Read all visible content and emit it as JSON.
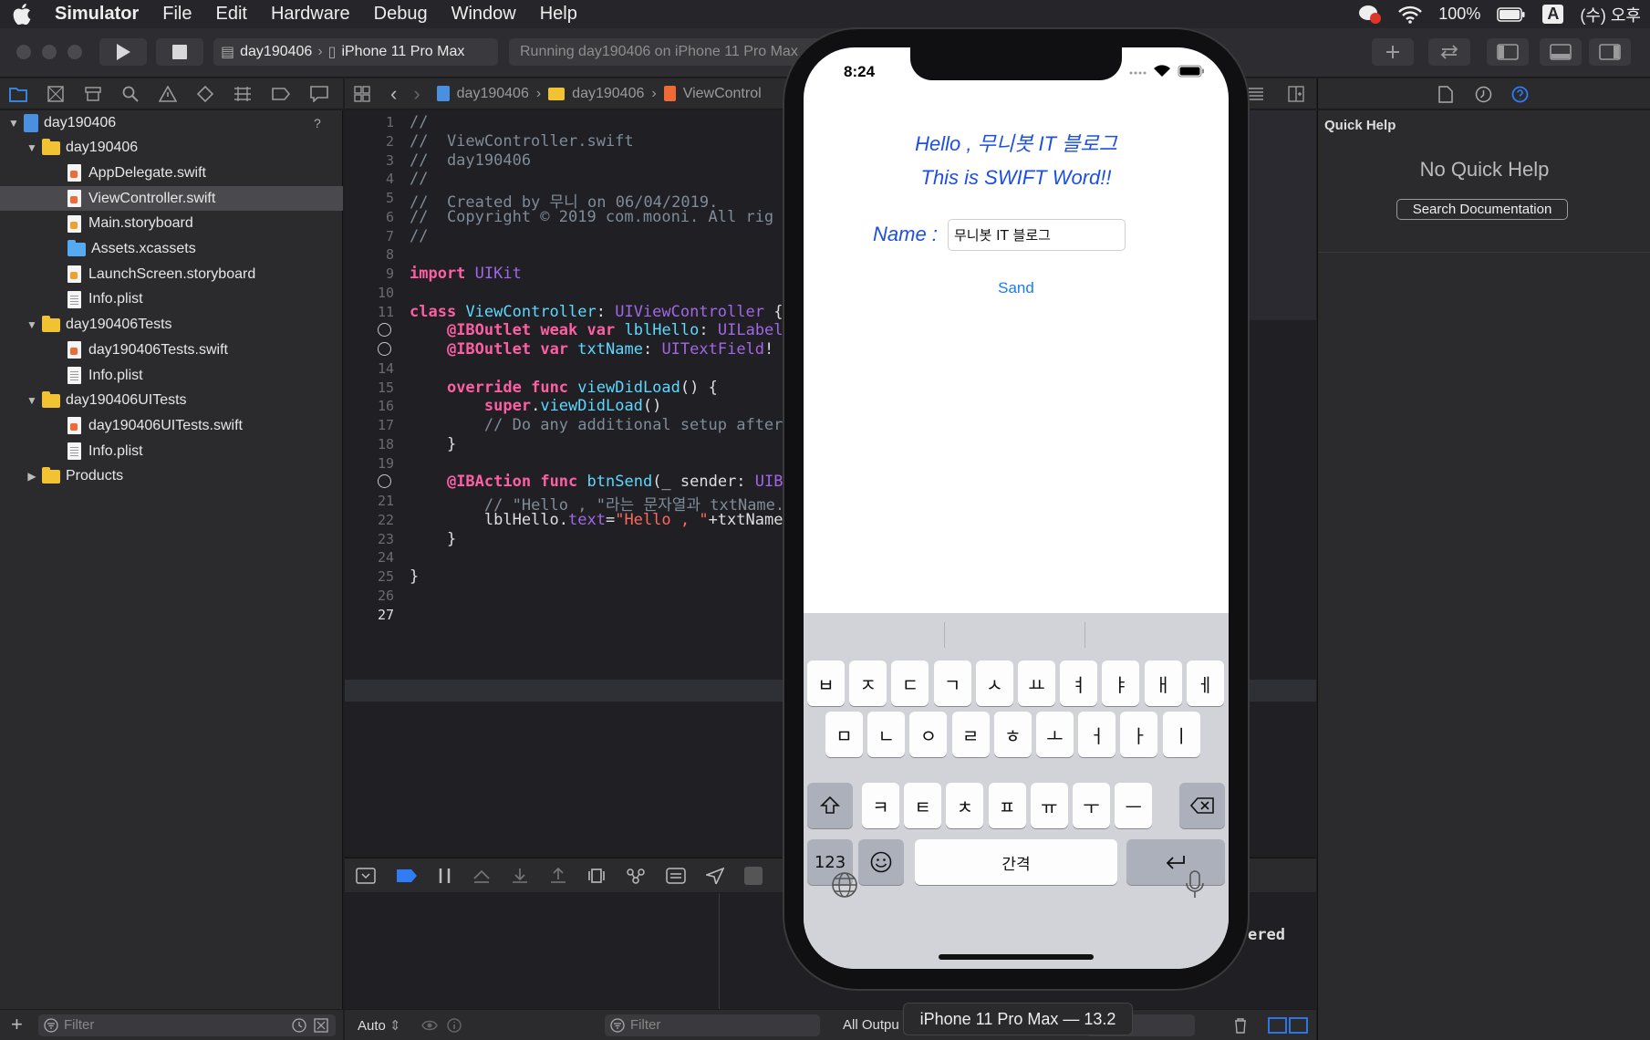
{
  "menubar": {
    "app_name": "Simulator",
    "items": [
      "File",
      "Edit",
      "Hardware",
      "Debug",
      "Window",
      "Help"
    ],
    "battery": "100%",
    "input_source": "A",
    "clock": "(수) 오후"
  },
  "toolbar": {
    "scheme_project": "day190406",
    "scheme_device": "iPhone 11 Pro Max",
    "activity": "Running day190406 on iPhone 11 Pro Max"
  },
  "navigator": {
    "badge": "?",
    "items": [
      {
        "label": "day190406",
        "kind": "project",
        "level": 0,
        "expanded": true
      },
      {
        "label": "day190406",
        "kind": "folder",
        "level": 1,
        "expanded": true
      },
      {
        "label": "AppDelegate.swift",
        "kind": "swift",
        "level": 2
      },
      {
        "label": "ViewController.swift",
        "kind": "swift",
        "level": 2,
        "selected": true
      },
      {
        "label": "Main.storyboard",
        "kind": "storyboard",
        "level": 2
      },
      {
        "label": "Assets.xcassets",
        "kind": "assets",
        "level": 2
      },
      {
        "label": "LaunchScreen.storyboard",
        "kind": "storyboard",
        "level": 2
      },
      {
        "label": "Info.plist",
        "kind": "plist",
        "level": 2
      },
      {
        "label": "day190406Tests",
        "kind": "folder",
        "level": 1,
        "expanded": true
      },
      {
        "label": "day190406Tests.swift",
        "kind": "swift",
        "level": 2
      },
      {
        "label": "Info.plist",
        "kind": "plist",
        "level": 2
      },
      {
        "label": "day190406UITests",
        "kind": "folder",
        "level": 1,
        "expanded": true
      },
      {
        "label": "day190406UITests.swift",
        "kind": "swift",
        "level": 2
      },
      {
        "label": "Info.plist",
        "kind": "plist",
        "level": 2
      },
      {
        "label": "Products",
        "kind": "folder",
        "level": 1,
        "expanded": false
      }
    ],
    "filter_placeholder": "Filter"
  },
  "jumpbar": {
    "crumbs": [
      "day190406",
      "day190406",
      "ViewControl"
    ]
  },
  "editor": {
    "current_line": 27,
    "breakpoint_lines": [
      12,
      13,
      20
    ],
    "lines": [
      "//",
      "//  ViewController.swift",
      "//  day190406",
      "//",
      "//  Created by 무니 on 06/04/2019.",
      "//  Copyright © 2019 com.mooni. All rig",
      "//",
      "",
      "import UIKit",
      "",
      "class ViewController: UIViewController {",
      "    @IBOutlet weak var lblHello: UILabel!",
      "    @IBOutlet var txtName: UITextField!",
      "",
      "    override func viewDidLoad() {",
      "        super.viewDidLoad()",
      "        // Do any additional setup after",
      "    }",
      "",
      "    @IBAction func btnSend(_ sender: UIB",
      "        // \"Hello , \"라는 문자열과 txtName.t",
      "        lblHello.text=\"Hello , \"+txtName",
      "    }",
      "",
      "}",
      "",
      ""
    ]
  },
  "debug": {
    "auto_label": "Auto",
    "filter_placeholder": "Filter",
    "output_label": "All Outpu",
    "console_text": "ered"
  },
  "inspector": {
    "title": "Quick Help",
    "empty_text": "No Quick Help",
    "search_button": "Search Documentation"
  },
  "phone": {
    "time": "8:24",
    "hello_label": "Hello , 무니봇 IT 블로그",
    "word_label": "This is SWIFT Word!!",
    "name_label": "Name :",
    "name_value": "무니봇 IT 블로그",
    "send_button": "Sand",
    "keyboard": {
      "row1": [
        "ㅂ",
        "ㅈ",
        "ㄷ",
        "ㄱ",
        "ㅅ",
        "ㅛ",
        "ㅕ",
        "ㅑ",
        "ㅐ",
        "ㅔ"
      ],
      "row2": [
        "ㅁ",
        "ㄴ",
        "ㅇ",
        "ㄹ",
        "ㅎ",
        "ㅗ",
        "ㅓ",
        "ㅏ",
        "ㅣ"
      ],
      "row3": [
        "ㅋ",
        "ㅌ",
        "ㅊ",
        "ㅍ",
        "ㅠ",
        "ㅜ",
        "ㅡ"
      ],
      "numbers": "123",
      "space": "간격"
    }
  },
  "simulator_label": "iPhone 11 Pro Max — 13.2",
  "colors": {
    "accent": "#1a7cf2",
    "phone_blue": "#1d4fe0",
    "selection": "#4a4a4e"
  }
}
